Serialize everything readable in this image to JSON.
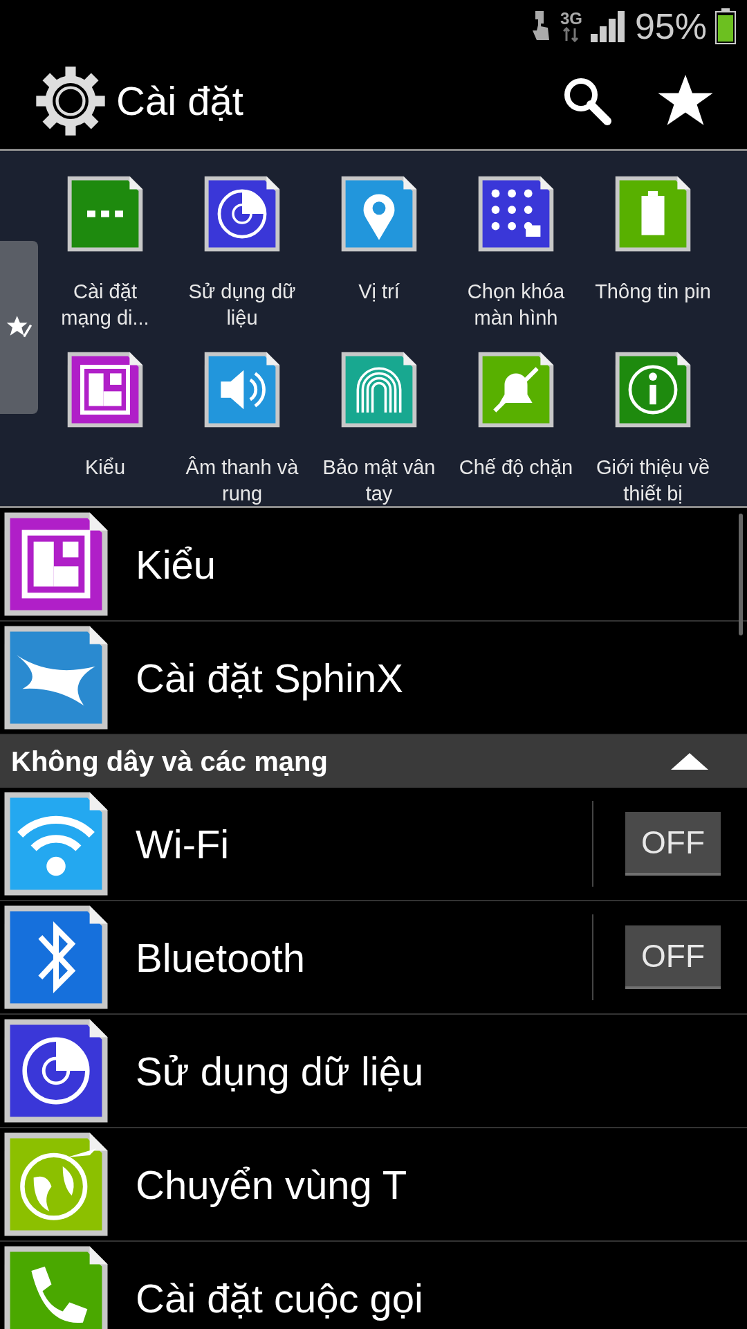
{
  "status_bar": {
    "network": "3G",
    "battery": "95%"
  },
  "action_bar": {
    "title": "Cài đặt"
  },
  "quick_settings": [
    {
      "label": "Cài đặt mạng di...",
      "color": "#1e8a0e"
    },
    {
      "label": "Sử dụng dữ liệu",
      "color": "#3a37d8"
    },
    {
      "label": "Vị trí",
      "color": "#2296dc"
    },
    {
      "label": "Chọn khóa màn hình",
      "color": "#3a37d8"
    },
    {
      "label": "Thông tin pin",
      "color": "#58b000"
    },
    {
      "label": "Kiểu",
      "color": "#b01fc8"
    },
    {
      "label": "Âm thanh và rung",
      "color": "#2296dc"
    },
    {
      "label": "Bảo mật vân tay",
      "color": "#18a890"
    },
    {
      "label": "Chế độ chặn",
      "color": "#58b000"
    },
    {
      "label": "Giới thiệu về thiết bị",
      "color": "#1e8a0e"
    }
  ],
  "list": [
    {
      "kind": "item",
      "label": "Kiểu",
      "color": "#b01fc8"
    },
    {
      "kind": "item",
      "label": "Cài đặt SphinX",
      "color": "#2a8ad0"
    },
    {
      "kind": "section",
      "label": "Không dây và các mạng",
      "expanded": true
    },
    {
      "kind": "toggle",
      "label": "Wi-Fi",
      "color": "#24a8f0",
      "switch": "OFF",
      "on": false
    },
    {
      "kind": "toggle",
      "label": "Bluetooth",
      "color": "#1670dc",
      "switch": "OFF",
      "on": false
    },
    {
      "kind": "item",
      "label": "Sử dụng dữ liệu",
      "color": "#3a37d8"
    },
    {
      "kind": "item",
      "label": "Chuyển vùng T",
      "color": "#8cc000"
    },
    {
      "kind": "item",
      "label": "Cài đặt cuộc gọi",
      "color": "#4aa800"
    }
  ]
}
